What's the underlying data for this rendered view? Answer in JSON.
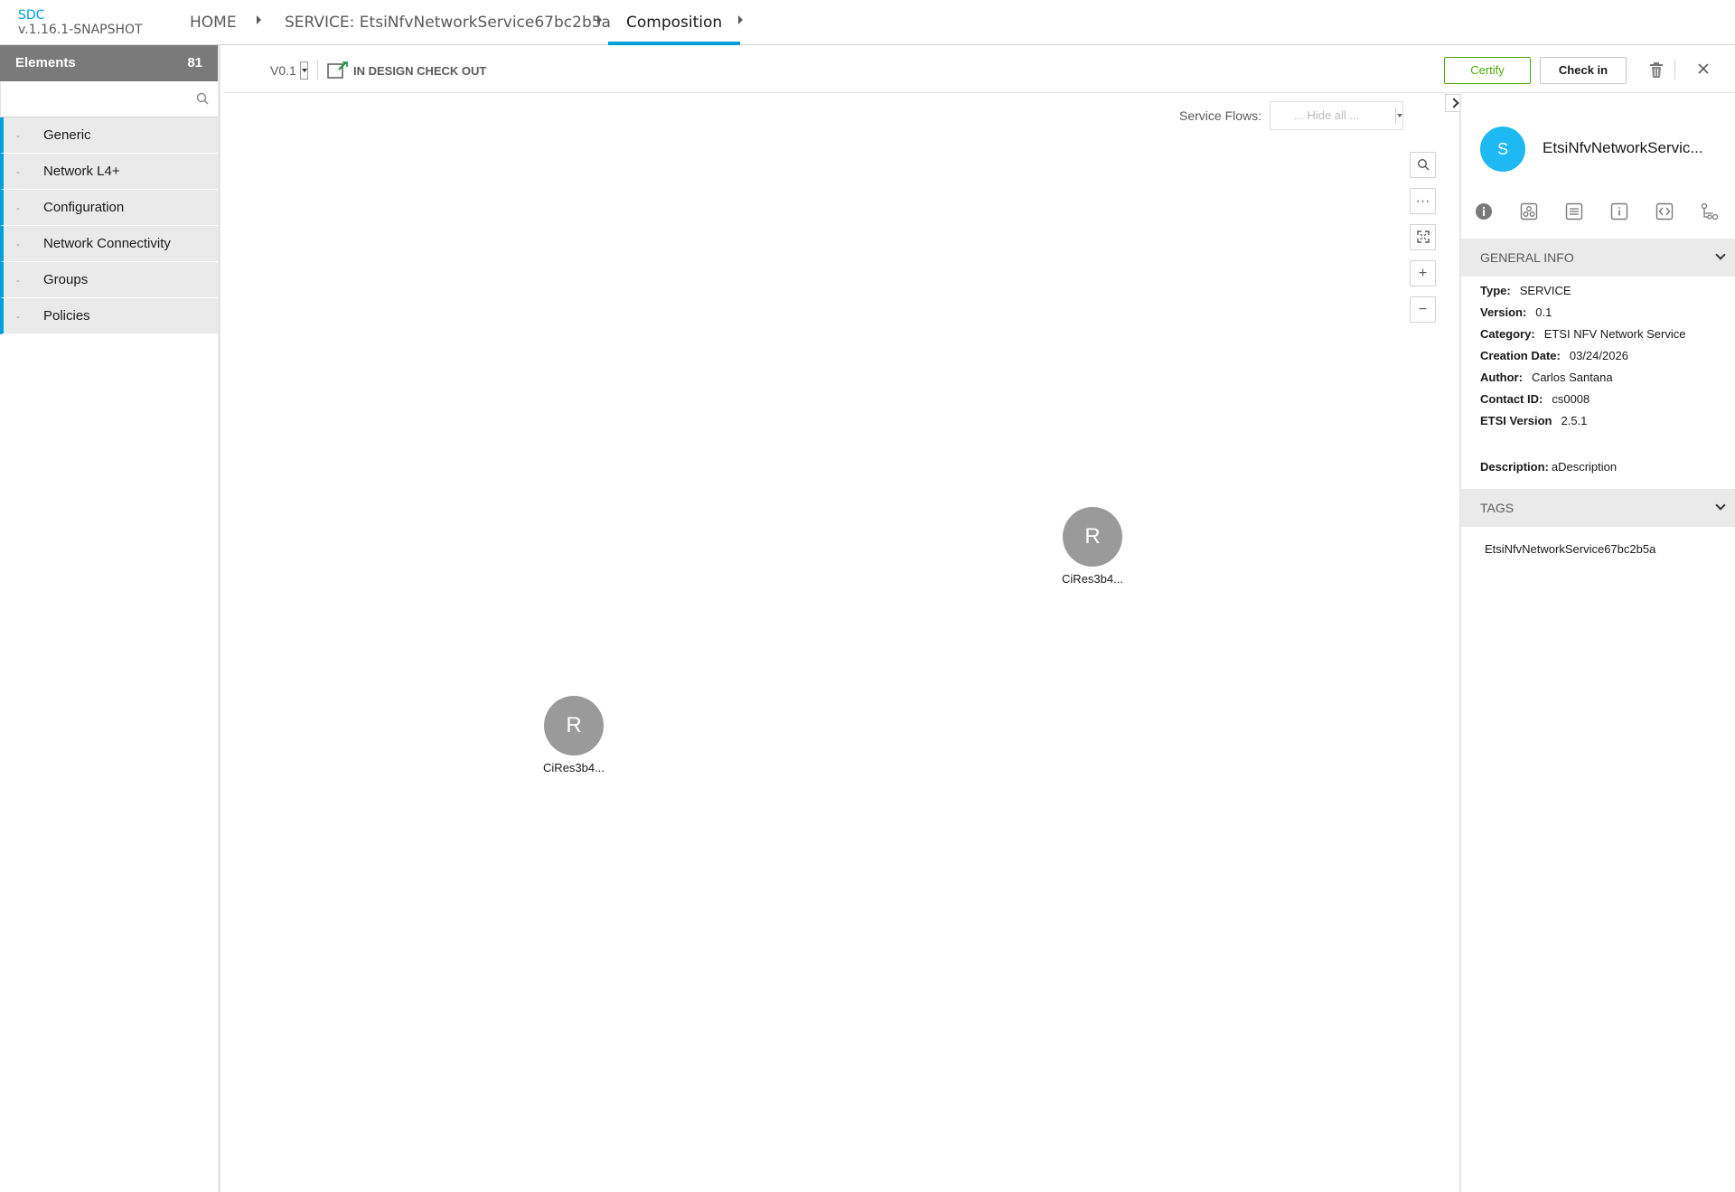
{
  "app": {
    "name": "SDC",
    "version": "v.1.16.1-SNAPSHOT"
  },
  "breadcrumbs": [
    {
      "label": "HOME"
    },
    {
      "label": "SERVICE: EtsiNfvNetworkService67bc2b5a"
    },
    {
      "label": "Composition"
    }
  ],
  "palette": {
    "title": "Elements",
    "count": "81",
    "search_placeholder": "",
    "items": [
      {
        "label": "Generic"
      },
      {
        "label": "Network L4+"
      },
      {
        "label": "Configuration"
      },
      {
        "label": "Network Connectivity"
      },
      {
        "label": "Groups"
      },
      {
        "label": "Policies"
      }
    ],
    "collapse_marker": "-"
  },
  "actionbar": {
    "version": "V0.1",
    "status": "IN DESIGN CHECK OUT",
    "certify_label": "Certify",
    "checkin_label": "Check in"
  },
  "canvas": {
    "flows_label": "Service Flows:",
    "flows_value": "... Hide all ...",
    "zoom_more": "···",
    "zoom_in": "+",
    "zoom_out": "−",
    "nodes": [
      {
        "letter": "R",
        "label": "CiRes3b4..."
      },
      {
        "letter": "R",
        "label": "CiRes3b4..."
      }
    ]
  },
  "details": {
    "avatar_letter": "S",
    "name": "EtsiNfvNetworkServic...",
    "general_info_title": "GENERAL INFO",
    "rows": [
      {
        "key": "Type:",
        "value": "SERVICE"
      },
      {
        "key": "Version:",
        "value": "0.1"
      },
      {
        "key": "Category:",
        "value": "ETSI NFV Network Service"
      },
      {
        "key": "Creation Date:",
        "value": "03/24/2026"
      },
      {
        "key": "Author:",
        "value": "Carlos Santana"
      },
      {
        "key": "Contact ID:",
        "value": "cs0008"
      },
      {
        "key": "ETSI Version",
        "value": "2.5.1"
      }
    ],
    "description_key": "Description:",
    "description_value": "aDescription",
    "tags_title": "TAGS",
    "tags": [
      "EtsiNfvNetworkService67bc2b5a"
    ]
  },
  "colors": {
    "accent": "#009fdb",
    "certify": "#4ca90c",
    "node": "#9a9a9a",
    "avatar": "#1eb9f3"
  }
}
